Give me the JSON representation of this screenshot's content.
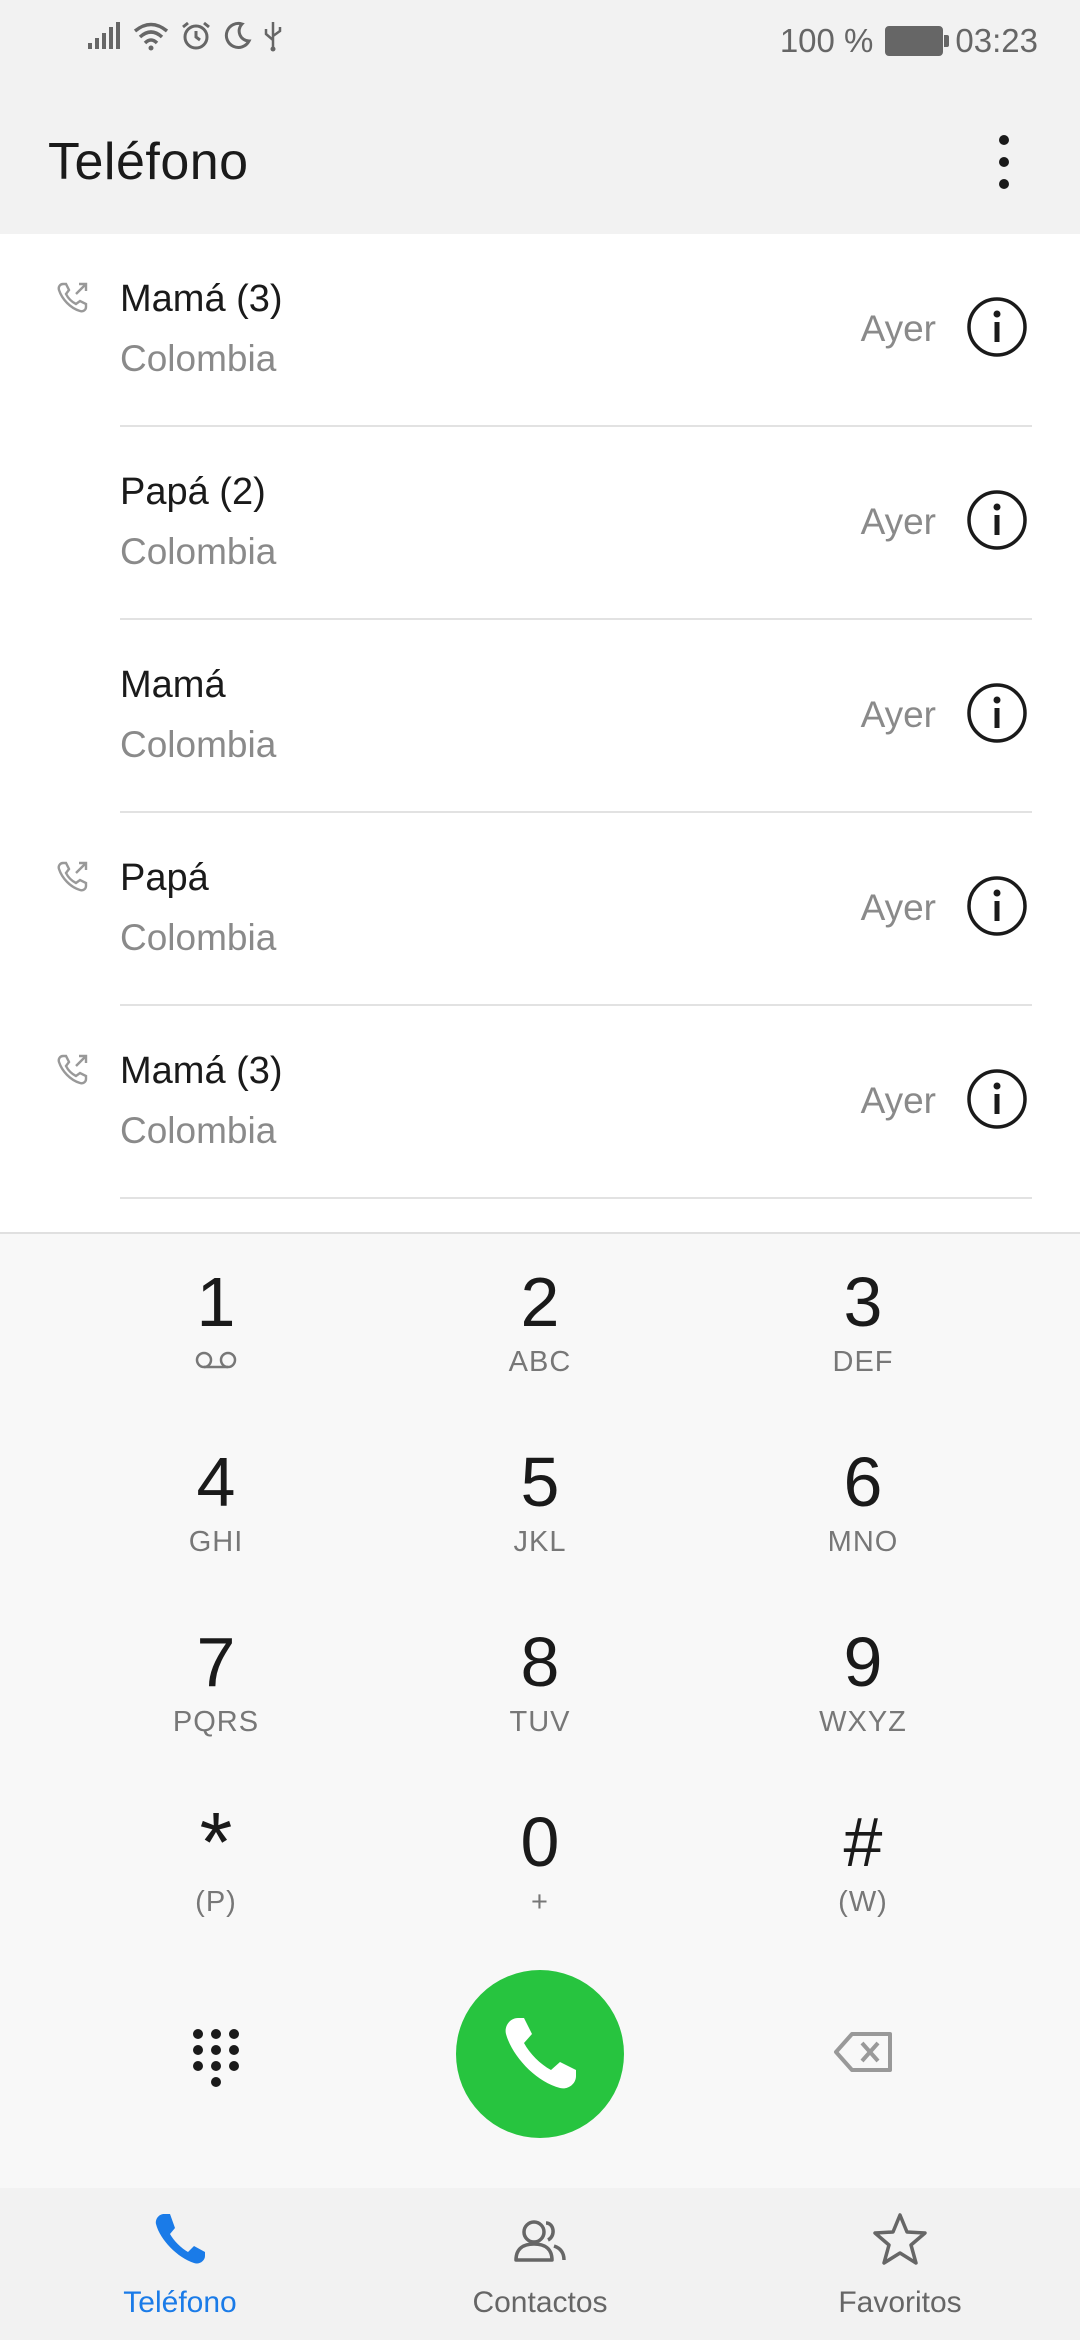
{
  "status_bar": {
    "battery_text": "100 %",
    "time": "03:23"
  },
  "app_bar": {
    "title": "Teléfono"
  },
  "calls": [
    {
      "name": "Mamá  (3)",
      "sub": "Colombia",
      "time": "Ayer",
      "outgoing": true
    },
    {
      "name": "Papá  (2)",
      "sub": "Colombia",
      "time": "Ayer",
      "outgoing": false
    },
    {
      "name": "Mamá",
      "sub": "Colombia",
      "time": "Ayer",
      "outgoing": false
    },
    {
      "name": "Papá",
      "sub": "Colombia",
      "time": "Ayer",
      "outgoing": true
    },
    {
      "name": "Mamá  (3)",
      "sub": "Colombia",
      "time": "Ayer",
      "outgoing": true
    }
  ],
  "dialpad": {
    "keys": [
      {
        "digit": "1",
        "letters": ""
      },
      {
        "digit": "2",
        "letters": "ABC"
      },
      {
        "digit": "3",
        "letters": "DEF"
      },
      {
        "digit": "4",
        "letters": "GHI"
      },
      {
        "digit": "5",
        "letters": "JKL"
      },
      {
        "digit": "6",
        "letters": "MNO"
      },
      {
        "digit": "7",
        "letters": "PQRS"
      },
      {
        "digit": "8",
        "letters": "TUV"
      },
      {
        "digit": "9",
        "letters": "WXYZ"
      },
      {
        "digit": "*",
        "letters": "(P)"
      },
      {
        "digit": "0",
        "letters": "+"
      },
      {
        "digit": "#",
        "letters": "(W)"
      }
    ]
  },
  "bottom_nav": [
    {
      "label": "Teléfono",
      "icon": "phone-icon",
      "active": true
    },
    {
      "label": "Contactos",
      "icon": "contacts-icon",
      "active": false
    },
    {
      "label": "Favoritos",
      "icon": "star-icon",
      "active": false
    }
  ],
  "colors": {
    "accent": "#1a7be8",
    "call_button": "#27c43f"
  }
}
